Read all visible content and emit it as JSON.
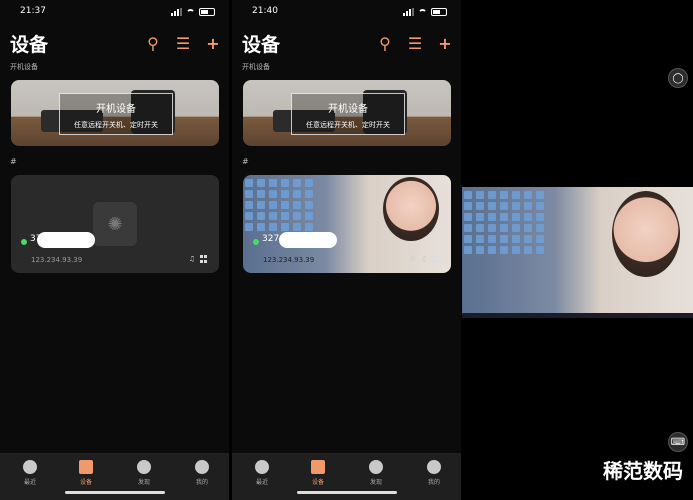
{
  "screens": [
    {
      "time": "21:37",
      "title": "设备",
      "section_power": "开机设备",
      "banner_title": "开机设备",
      "banner_subtitle": "任意远程开关机、定时开关",
      "section_hash": "#",
      "device_name_prefix": "37",
      "device_ip": "123.234.93.39"
    },
    {
      "time": "21:40",
      "title": "设备",
      "section_power": "开机设备",
      "banner_title": "开机设备",
      "banner_subtitle": "任意远程开关机、定时开关",
      "section_hash": "#",
      "device_name_prefix": "3276",
      "device_ip": "123.234.93.39"
    }
  ],
  "tabs": [
    "最近",
    "设备",
    "发现",
    "我的"
  ],
  "active_tab": "设备",
  "icons": {
    "search": "search-icon",
    "menu": "menu-icon",
    "add": "plus-icon",
    "bell": "bell-icon",
    "windows": "windows-icon",
    "keyboard": "keyboard-icon"
  },
  "accent_color": "#f09a6c",
  "online_color": "#4cd964",
  "watermark": "稀范数码"
}
